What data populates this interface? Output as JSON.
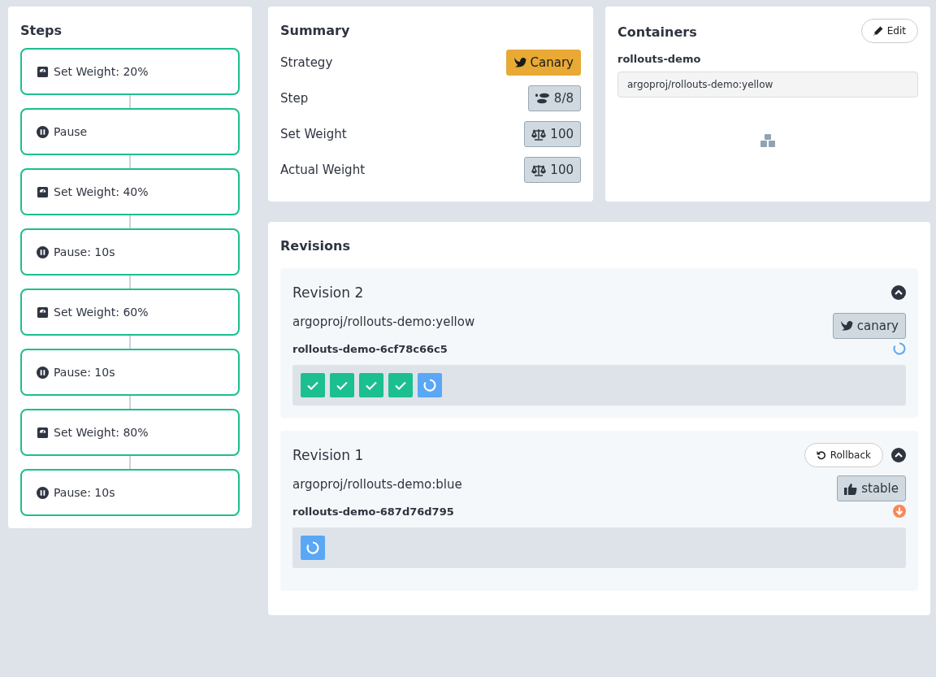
{
  "steps": {
    "title": "Steps",
    "items": [
      {
        "kind": "weight",
        "label": "Set Weight: 20%"
      },
      {
        "kind": "pause",
        "label": "Pause"
      },
      {
        "kind": "weight",
        "label": "Set Weight: 40%"
      },
      {
        "kind": "pause",
        "label": "Pause: 10s"
      },
      {
        "kind": "weight",
        "label": "Set Weight: 60%"
      },
      {
        "kind": "pause",
        "label": "Pause: 10s"
      },
      {
        "kind": "weight",
        "label": "Set Weight: 80%"
      },
      {
        "kind": "pause",
        "label": "Pause: 10s"
      }
    ]
  },
  "summary": {
    "title": "Summary",
    "rows": [
      {
        "label": "Strategy",
        "value": "Canary",
        "kind": "strategy"
      },
      {
        "label": "Step",
        "value": "8/8",
        "kind": "step"
      },
      {
        "label": "Set Weight",
        "value": "100",
        "kind": "weight"
      },
      {
        "label": "Actual Weight",
        "value": "100",
        "kind": "weight"
      }
    ]
  },
  "containers": {
    "title": "Containers",
    "edit_button": "Edit",
    "name": "rollouts-demo",
    "image": "argoproj/rollouts-demo:yellow"
  },
  "revisions": {
    "title": "Revisions",
    "items": [
      {
        "title": "Revision 2",
        "image": "argoproj/rollouts-demo:yellow",
        "tag": {
          "kind": "canary",
          "label": "canary"
        },
        "replicaset": {
          "kind": "progressing",
          "name": "rollouts-demo-6cf78c66c5"
        },
        "expanded": true,
        "pods": [
          {
            "kind": "ok"
          },
          {
            "kind": "ok"
          },
          {
            "kind": "ok"
          },
          {
            "kind": "ok"
          },
          {
            "kind": "pending"
          }
        ]
      },
      {
        "title": "Revision 1",
        "image": "argoproj/rollouts-demo:blue",
        "tag": {
          "kind": "stable",
          "label": "stable"
        },
        "replicaset": {
          "kind": "scaled-down",
          "name": "rollouts-demo-687d76d795"
        },
        "rollback": "Rollback",
        "expanded": true,
        "pods": [
          {
            "kind": "pending"
          }
        ]
      }
    ]
  }
}
